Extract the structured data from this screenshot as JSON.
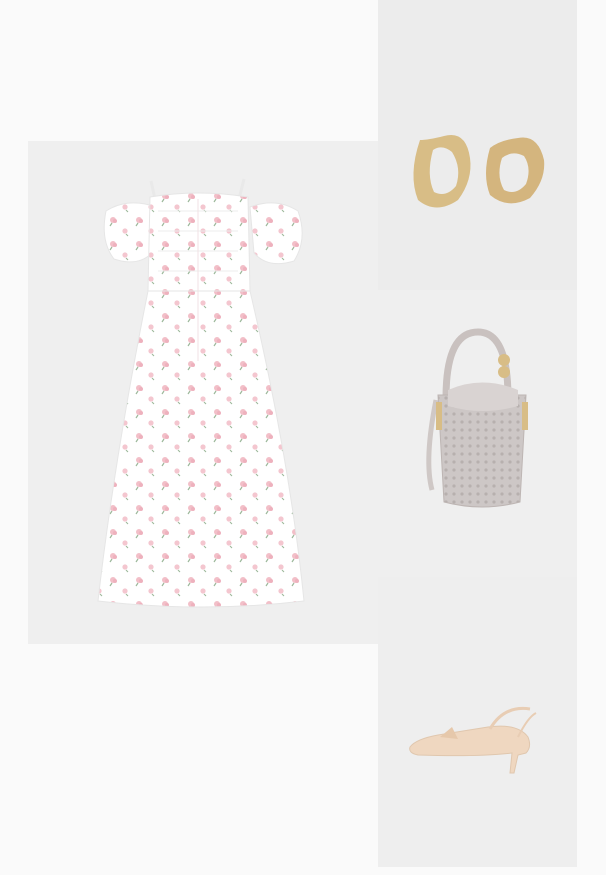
{
  "outfit": {
    "items": [
      {
        "name": "dress",
        "icon": "floral-off-shoulder-dress"
      },
      {
        "name": "earrings",
        "icon": "gold-hoop-earrings"
      },
      {
        "name": "bag",
        "icon": "perforated-bucket-bag"
      },
      {
        "name": "shoes",
        "icon": "slingback-kitten-heels"
      }
    ]
  },
  "colors": {
    "page": "#fafafa",
    "panel": "#eeeeee",
    "dress": "#ffffff",
    "print_pink": "#f2bfc8",
    "print_green": "#9cb89a",
    "gold": "#d8bd86",
    "bag": "#cdc7c6",
    "shoe": "#efd7c0"
  }
}
